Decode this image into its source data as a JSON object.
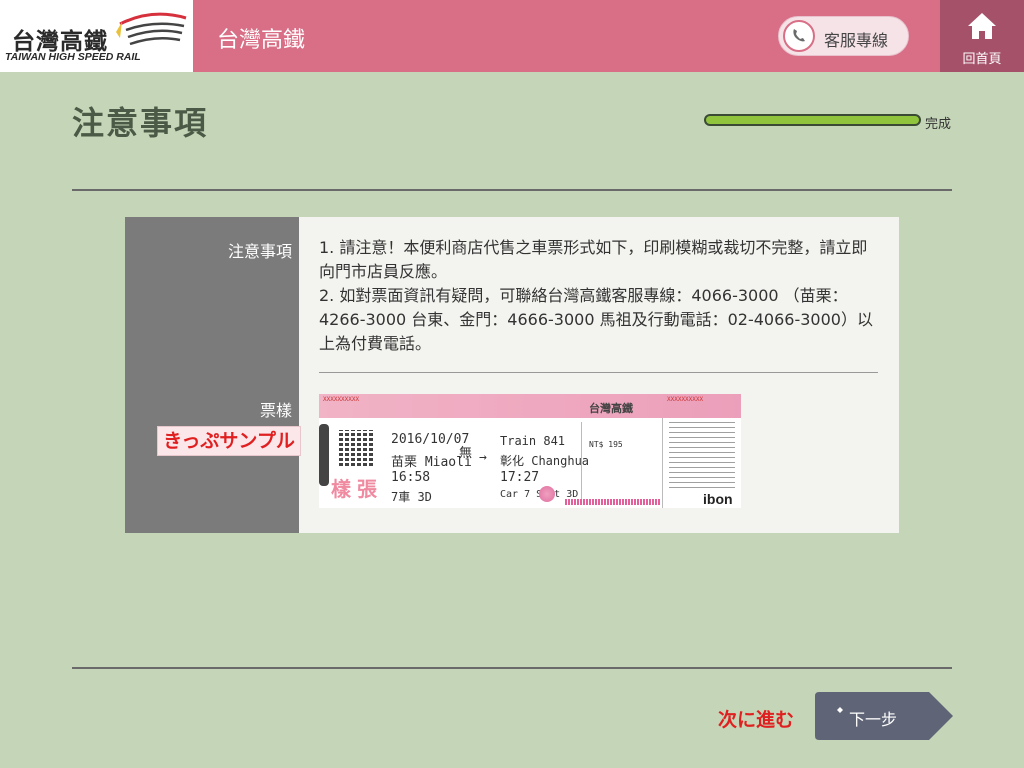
{
  "header": {
    "logo_cn": "台灣高鐵",
    "logo_en": "TAIWAN HIGH SPEED RAIL",
    "title": "台灣高鐵",
    "hotline_label": "客服專線",
    "home_label": "回首頁"
  },
  "page": {
    "title": "注意事項",
    "progress_label": "完成",
    "progress_fraction": 1.0
  },
  "card": {
    "notice_label": "注意事項",
    "notice_1": "1. 請注意！本便利商店代售之車票形式如下，印刷模糊或裁切不完整，請立即向門市店員反應。",
    "notice_2": "2. 如對票面資訊有疑問，可聯絡台灣高鐵客服專線：4066-3000 （苗栗：4266-3000 台東、金門：4666-3000 馬祖及行動電話：02-4066-3000）以上為付費電話。",
    "sample_label": "票樣",
    "sample_jp": "きっぷサンプル"
  },
  "ticket": {
    "serial_top": "XXXXXXXXXX",
    "serial_right": "XXXXXXXXXX",
    "logo_text": "台灣高鐵",
    "date": "2016/10/07",
    "origin": "苗栗 Miaoli",
    "dest": "彰化 Changhua",
    "depart_time": "16:58",
    "arrive_time": "17:27",
    "train": "Train 841",
    "car_seat_cn": "7車 3D",
    "car_seat_en": "Car 7  Seat 3D",
    "no_smoking": "無",
    "price": "NT$ 195",
    "stamp": "樣張",
    "bon": "ibon"
  },
  "footer": {
    "next_jp": "次に進む",
    "next_label": "下一步"
  },
  "colors": {
    "header_bg": "#d86f86",
    "home_bg": "#a55169",
    "page_bg": "#c5d5b7",
    "progress_fill": "#8fc43c",
    "next_btn": "#5f6577",
    "jp_red": "#e02020"
  }
}
